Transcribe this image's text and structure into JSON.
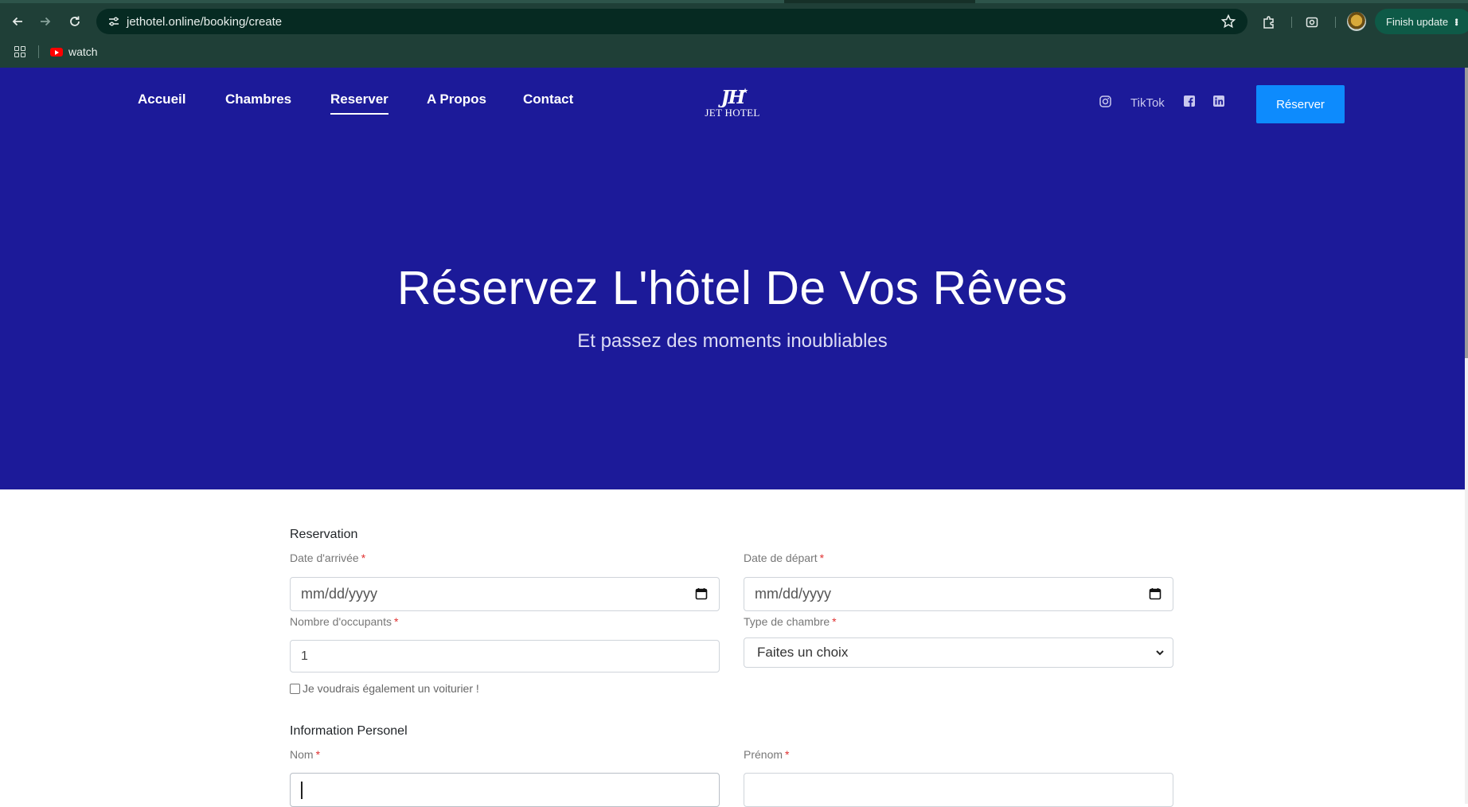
{
  "browser": {
    "url": "jethotel.online/booking/create",
    "bookmarks": [
      {
        "label": "watch",
        "icon": "youtube-icon"
      }
    ],
    "update_button": "Finish update",
    "icons": [
      "back-icon",
      "forward-icon",
      "reload-icon",
      "site-info-icon",
      "bookmark-star-icon",
      "extensions-icon",
      "screenshot-icon",
      "profile-avatar",
      "apps-grid-icon"
    ]
  },
  "site": {
    "nav": [
      {
        "label": "Accueil"
      },
      {
        "label": "Chambres"
      },
      {
        "label": "Reserver",
        "active": true
      },
      {
        "label": "A Propos"
      },
      {
        "label": "Contact"
      }
    ],
    "logo": {
      "monogram": "JH",
      "name": "JET HOTEL"
    },
    "social": {
      "tiktok": "TikTok",
      "icons": [
        "instagram-icon",
        "facebook-icon",
        "linkedin-icon"
      ]
    },
    "cta": "Réserver",
    "hero": {
      "title": "Réservez L'hôtel De Vos Rêves",
      "subtitle": "Et passez des moments inoubliables"
    }
  },
  "form": {
    "reservation": {
      "title": "Reservation",
      "arrival_label": "Date d'arrivée",
      "arrival_placeholder": "mm/dd/yyyy",
      "departure_label": "Date de départ",
      "departure_placeholder": "mm/dd/yyyy",
      "occupants_label": "Nombre d'occupants",
      "occupants_value": "1",
      "room_type_label": "Type de chambre",
      "room_type_value": "Faites un choix",
      "valet_label": "Je voudrais également un voiturier !",
      "valet_checked": false
    },
    "personal": {
      "title": "Information Personel",
      "nom_label": "Nom",
      "nom_value": "",
      "prenom_label": "Prénom",
      "prenom_value": ""
    },
    "required_marker": "*"
  },
  "colors": {
    "hero_bg": "#1c1a99",
    "cta_bg": "#0d8bfd",
    "chrome_bg": "#1f3f37",
    "required": "#e03131"
  }
}
